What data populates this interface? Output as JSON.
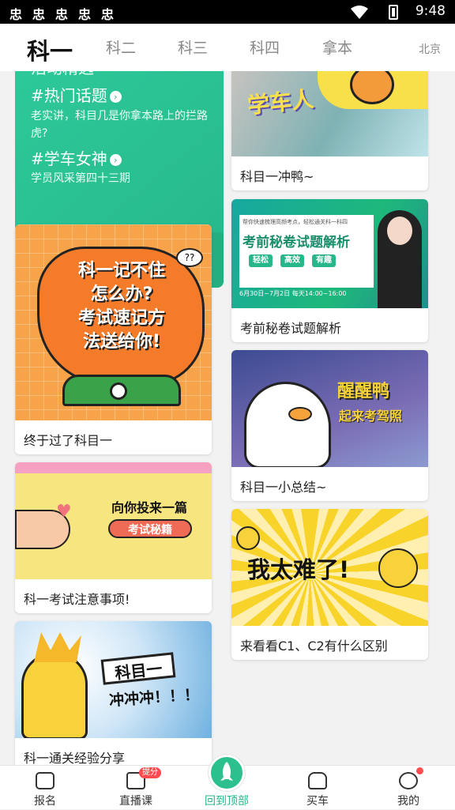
{
  "status_bar": {
    "time": "9:48",
    "notif_icons": [
      "忠",
      "忠",
      "忠",
      "忠",
      "忠"
    ]
  },
  "tabs": {
    "items": [
      "科一",
      "科二",
      "科三",
      "科四",
      "拿本"
    ],
    "active": "科一",
    "city": "北京"
  },
  "green_card": {
    "cut_title": "活动精选",
    "topics": [
      {
        "title": "#热门话题",
        "desc": "老实讲，科目几是你拿本路上的拦路虎?"
      },
      {
        "title": "#学车女神",
        "desc": "学员风采第四十三期"
      }
    ]
  },
  "left_cards": [
    {
      "caption": "终于过了科目一",
      "art_text": [
        "科一记不住",
        "怎么办?",
        "考试速记方",
        "法送给你!"
      ]
    },
    {
      "caption": "科一考试注意事项!",
      "art_text": [
        "向你投来一篇",
        "考试秘籍"
      ]
    },
    {
      "caption": "科一通关经验分享",
      "art_text": [
        "科目一",
        "冲冲冲！！！"
      ]
    }
  ],
  "right_cards": [
    {
      "caption": "科目一冲鸭~",
      "art_text": [
        "学车人"
      ]
    },
    {
      "caption": "考前秘卷试题解析",
      "art_text": [
        "考前秘卷试题解析",
        "轻松",
        "高效",
        "有趣",
        "6月30日~7月2日 每天14:00~16:00",
        "帮你快速梳理高频考点，轻松通关科一科四"
      ]
    },
    {
      "caption": "科目一小总结~",
      "art_text": [
        "醒醒鸭",
        "起来考驾照"
      ]
    },
    {
      "caption": "来看看C1、C2有什么区别",
      "art_text": [
        "我太难了!"
      ]
    }
  ],
  "bottom_nav": [
    {
      "label": "报名",
      "icon": "signup-icon"
    },
    {
      "label": "直播课",
      "icon": "live-icon",
      "badge": "提分"
    },
    {
      "label": "回到顶部",
      "icon": "rocket-icon"
    },
    {
      "label": "买车",
      "icon": "car-icon"
    },
    {
      "label": "我的",
      "icon": "profile-icon"
    }
  ],
  "colors": {
    "accent": "#27b78a",
    "badge": "#ff4d4f"
  }
}
